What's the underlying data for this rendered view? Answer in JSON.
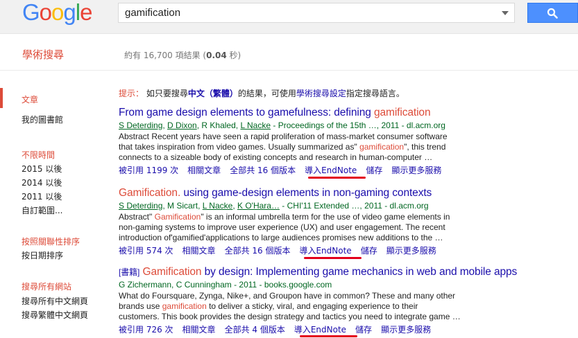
{
  "header": {
    "logo_letters": [
      "G",
      "o",
      "o",
      "g",
      "l",
      "e"
    ],
    "search_query": "gamification"
  },
  "subheader": {
    "title": "學術搜尋",
    "stats_prefix": "約有 16,700 項結果 (",
    "stats_time": "0.04",
    "stats_suffix": " 秒)"
  },
  "sidebar": {
    "articles": "文章",
    "my_library": "我的圖書館",
    "time_any": "不限時間",
    "since_2015": "2015 以後",
    "since_2014": "2014 以後",
    "since_2011": "2011 以後",
    "custom_range": "自訂範圍...",
    "sort_relevance": "按照關聯性排序",
    "sort_date": "按日期排序",
    "search_all_web": "搜尋所有網站",
    "search_all_chinese": "搜尋所有中文網頁",
    "search_traditional": "搜尋繁體中文網頁"
  },
  "hint": {
    "label": "提示：",
    "text1": " 如只要搜尋",
    "bold": "中文（繁體）",
    "text2": "的結果，可使用",
    "link": "學術搜尋設定",
    "text3": "指定搜尋語言。"
  },
  "results": [
    {
      "title_pre": "From game design elements to gamefulness: defining ",
      "title_hl": "gamification",
      "authors_links": [
        "S Deterding",
        "D Dixon"
      ],
      "authors_plain": "R Khaled",
      "authors_link3": "L Nacke",
      "source": " - Proceedings of the 15th …, 2011 - dl.acm.org",
      "abstract1": "Abstract Recent years have seen a rapid proliferation of mass-market consumer software",
      "abstract2a": "that takes inspiration from video games. Usually summarized as\" ",
      "abstract2hl": "gamification",
      "abstract2b": "\", this trend",
      "abstract3": "connects to a sizeable body of existing concepts and research in human-computer …",
      "cited": "被引用 1199 次",
      "related": "相關文章",
      "versions": "全部共 16 個版本",
      "endnote": "導入EndNote",
      "save": "儲存",
      "more": "顯示更多服務"
    },
    {
      "title_hl": "Gamification.",
      "title_post": " using game-design elements in non-gaming contexts",
      "author1": "S Deterding",
      "author2": "M Sicart",
      "author3": "L Nacke",
      "author4": "K O'Hara…",
      "source": " - CHI'11 Extended …, 2011 - dl.acm.org",
      "abstract1a": "Abstract\" ",
      "abstract1hl": "Gamification",
      "abstract1b": "\" is an informal umbrella term for the use of video game elements in",
      "abstract2": "non-gaming systems to improve user experience (UX) and user engagement. The recent",
      "abstract3": "introduction of'gamified'applications to large audiences promises new additions to the …",
      "cited": "被引用 574 次",
      "related": "相關文章",
      "versions": "全部共 16 個版本",
      "endnote": "導入EndNote",
      "save": "儲存",
      "more": "顯示更多服務"
    },
    {
      "tag": "[書籍]",
      "title_hl": "Gamification",
      "title_post": " by design: Implementing game mechanics in web and mobile apps",
      "authors": "G Zichermann, C Cunningham - 2011 - books.google.com",
      "abstract1": "What do Foursquare, Zynga, Nike+, and Groupon have in common? These and many other",
      "abstract2a": "brands use ",
      "abstract2hl": "gamification",
      "abstract2b": " to deliver a sticky, viral, and engaging experience to their",
      "abstract3": "customers. This book provides the design strategy and tactics you need to integrate game …",
      "cited": "被引用 726 次",
      "related": "相關文章",
      "versions": "全部共 4 個版本",
      "endnote": "導入EndNote",
      "save": "儲存",
      "more": "顯示更多服務"
    }
  ],
  "colors": {
    "accent_red": "#dd4b39",
    "link_blue": "#1a0dab",
    "green": "#006621",
    "annotation_red": "#e3001b"
  }
}
